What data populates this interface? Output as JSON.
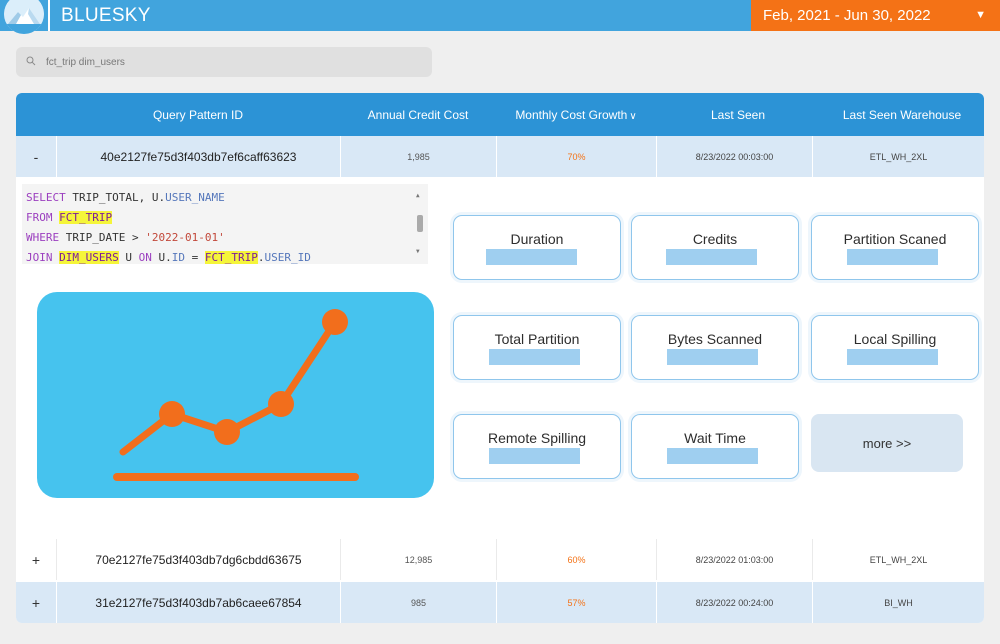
{
  "app": {
    "brand": "BLUESKY"
  },
  "date_range": {
    "label": "Feb, 2021 - Jun 30, 2022",
    "caret": "▼"
  },
  "search": {
    "value": "fct_trip dim_users"
  },
  "table": {
    "columns": {
      "pattern_id": "Query Pattern ID",
      "annual_cost": "Annual Credit Cost",
      "monthly_growth": "Monthly Cost Growth",
      "last_seen": "Last Seen",
      "last_warehouse": "Last Seen Warehouse"
    },
    "rows": [
      {
        "toggle": "-",
        "pattern_id": "40e2127fe75d3f403db7ef6caff63623",
        "annual_cost": "1,985",
        "growth": "70%",
        "last_seen": "8/23/2022 00:03:00",
        "warehouse": "ETL_WH_2XL"
      },
      {
        "toggle": "+",
        "pattern_id": "70e2127fe75d3f403db7dg6cbdd63675",
        "annual_cost": "12,985",
        "growth": "60%",
        "last_seen": "8/23/2022 01:03:00",
        "warehouse": "ETL_WH_2XL"
      },
      {
        "toggle": "+",
        "pattern_id": "31e2127fe75d3f403db7ab6caee67854",
        "annual_cost": "985",
        "growth": "57%",
        "last_seen": "8/23/2022 00:24:00",
        "warehouse": "BI_WH"
      }
    ]
  },
  "detail": {
    "sql": {
      "l1_kw": "SELECT",
      "l1_a": " TRIP_TOTAL, U.",
      "l1_b": "USER_NAME",
      "l2_kw": "FROM",
      "l2_hl": "FCT_TRIP",
      "l3_kw": "WHERE",
      "l3_a": " TRIP_DATE > ",
      "l3_str": "'2022-01-01'",
      "l4_kw": "JOIN",
      "l4_hl": "DIM_USERS",
      "l4_a": " U ",
      "l4_kw2": "ON",
      "l4_b": " U.",
      "l4_id1": "ID",
      "l4_c": " = ",
      "l4_hl2": "FCT_TRIP",
      "l4_d": ".",
      "l4_id2": "USER_ID"
    },
    "metrics": [
      "Duration",
      "Credits",
      "Partition Scaned",
      "Total Partition",
      "Bytes Scanned",
      "Local Spilling",
      "Remote Spilling",
      "Wait Time"
    ],
    "more_label": "more >>"
  },
  "colors": {
    "header": "#41a4dd",
    "accent": "#f47216",
    "chart_bg": "#46c3ee",
    "table_head": "#2c93d6"
  }
}
